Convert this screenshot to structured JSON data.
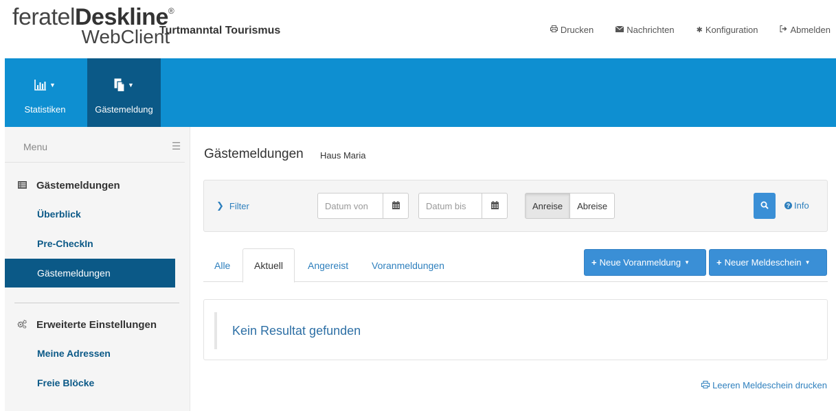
{
  "logo": {
    "brand_light": "feratel",
    "brand_bold": "Deskline",
    "registered": "®",
    "product": "WebClient"
  },
  "header": {
    "organization": "Turtmanntal Tourismus",
    "links": [
      {
        "label": "Drucken",
        "icon": "print-icon"
      },
      {
        "label": "Nachrichten",
        "icon": "envelope-icon"
      },
      {
        "label": "Konfiguration",
        "icon": "gear-icon"
      },
      {
        "label": "Abmelden",
        "icon": "sign-out-icon"
      }
    ]
  },
  "navbar": {
    "color": "#0e8fd1",
    "active_color": "#0b5987",
    "items": [
      {
        "label": "Statistiken",
        "icon": "bar-chart-icon"
      },
      {
        "label": "Gästemeldung",
        "icon": "documents-icon"
      }
    ]
  },
  "sidebar": {
    "menu_label": "Menu",
    "section1": {
      "title": "Gästemeldungen",
      "icon": "list-icon",
      "items": [
        "Überblick",
        "Pre-CheckIn",
        "Gästemeldungen"
      ],
      "active_index": 2
    },
    "section2": {
      "title": "Erweiterte Einstellungen",
      "icon": "cogs-icon",
      "items": [
        "Meine Adressen",
        "Freie Blöcke"
      ]
    }
  },
  "main": {
    "title": "Gästemeldungen",
    "subtitle": "Haus Maria",
    "filter": {
      "label": "Filter",
      "date_from_placeholder": "Datum von",
      "date_to_placeholder": "Datum bis",
      "toggle": [
        "Anreise",
        "Abreise"
      ],
      "selected": "Anreise",
      "info_label": "Info"
    },
    "tabs": [
      "Alle",
      "Aktuell",
      "Angereist",
      "Voranmeldungen"
    ],
    "active_tab": "Aktuell",
    "buttons": {
      "new_pre_registration": "Neue Voranmeldung",
      "new_registration_form": "Neuer Meldeschein"
    },
    "empty_message": "Kein Resultat gefunden",
    "print_empty_form": "Leeren Meldeschein drucken"
  }
}
